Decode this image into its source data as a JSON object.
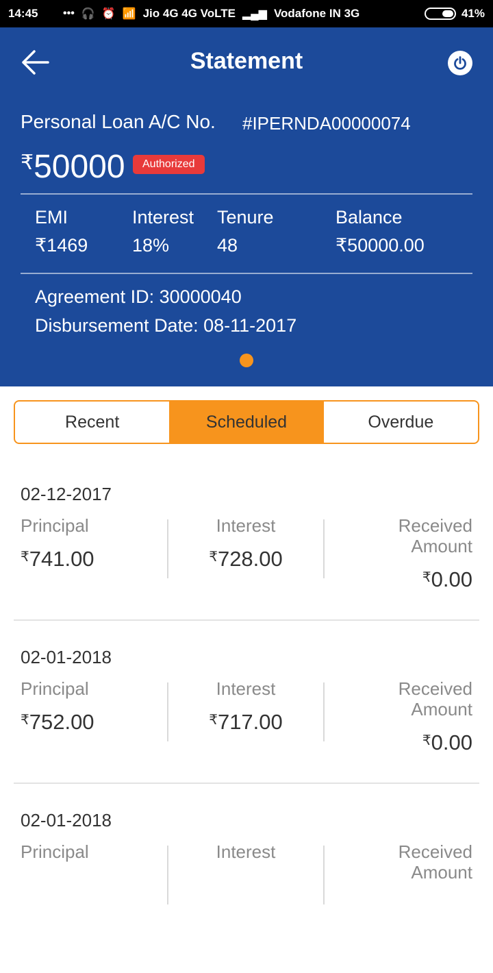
{
  "status": {
    "time": "14:45",
    "carrier1": "Jio 4G 4G VoLTE",
    "carrier2": "Vodafone IN 3G",
    "battery": "41%"
  },
  "header": {
    "title": "Statement",
    "account_label": "Personal Loan A/C No.",
    "account_number": "#IPERNDA00000074",
    "amount_symbol": "₹",
    "amount": "50000",
    "status_badge": "Authorized",
    "stats": [
      {
        "label": "EMI",
        "value": "₹1469"
      },
      {
        "label": "Interest",
        "value": "18%"
      },
      {
        "label": "Tenure",
        "value": "48"
      },
      {
        "label": "Balance",
        "value": "₹50000.00"
      }
    ],
    "agreement": "Agreement ID: 30000040",
    "disbursement": "Disbursement Date:  08-11-2017"
  },
  "tabs": [
    {
      "label": "Recent",
      "active": false
    },
    {
      "label": "Scheduled",
      "active": true
    },
    {
      "label": "Overdue",
      "active": false
    }
  ],
  "schedule": [
    {
      "date": "02-12-2017",
      "principal_label": "Principal",
      "principal": "741.00",
      "interest_label": "Interest",
      "interest": "728.00",
      "received_label_1": "Received",
      "received_label_2": "Amount",
      "received": "0.00"
    },
    {
      "date": "02-01-2018",
      "principal_label": "Principal",
      "principal": "752.00",
      "interest_label": "Interest",
      "interest": "717.00",
      "received_label_1": "Received",
      "received_label_2": "Amount",
      "received": "0.00"
    },
    {
      "date": "02-01-2018",
      "principal_label": "Principal",
      "principal": "",
      "interest_label": "Interest",
      "interest": "",
      "received_label_1": "Received",
      "received_label_2": "Amount",
      "received": ""
    }
  ],
  "currency_symbol": "₹",
  "colors": {
    "header_bg": "#1c4a9a",
    "accent": "#f7941d",
    "badge": "#e83a3a"
  }
}
